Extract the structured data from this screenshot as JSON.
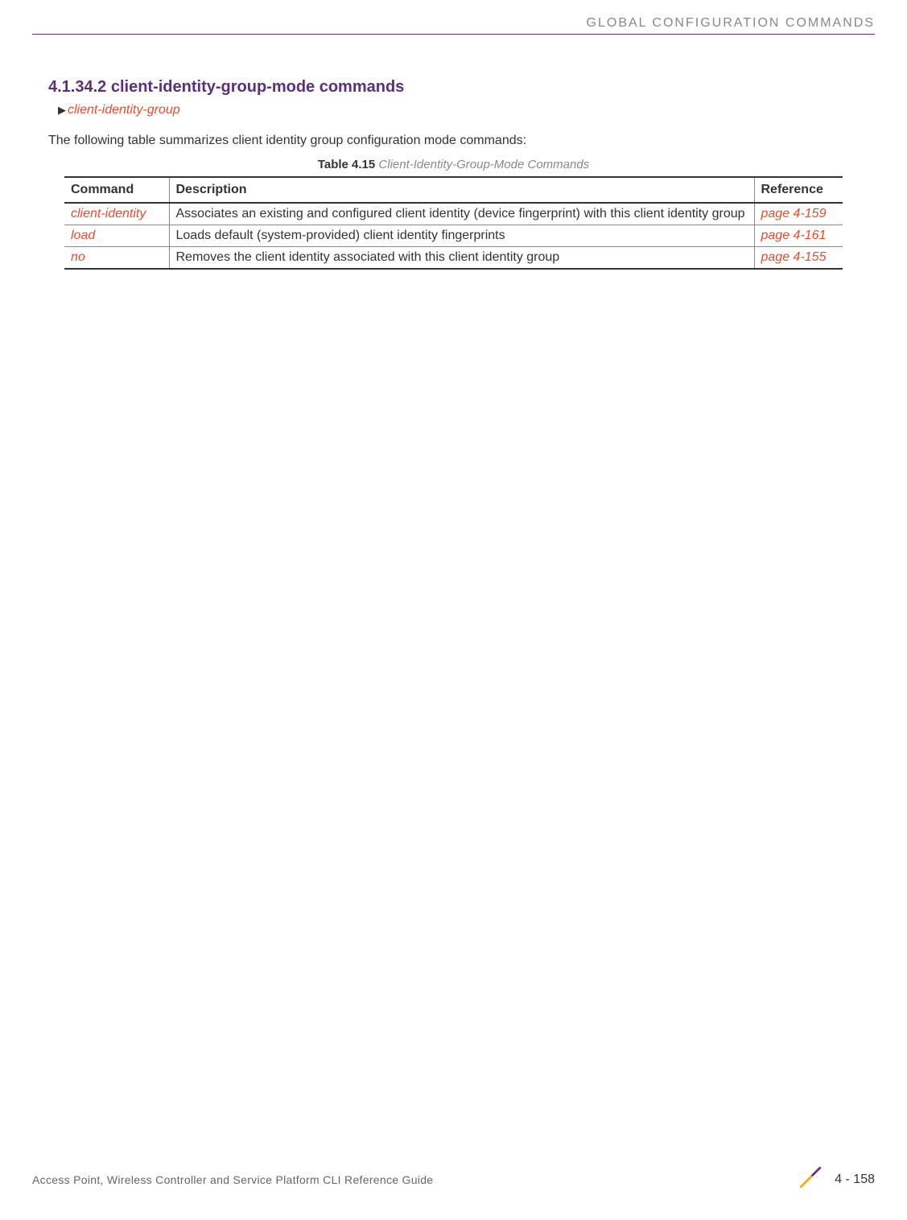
{
  "header": {
    "running_title": "GLOBAL CONFIGURATION COMMANDS"
  },
  "section": {
    "number_and_title": "4.1.34.2 client-identity-group-mode commands",
    "breadcrumb": "client-identity-group",
    "intro": "The following table summarizes client identity group configuration mode commands:"
  },
  "table": {
    "caption_label": "Table 4.15",
    "caption_title": " Client-Identity-Group-Mode Commands",
    "headers": {
      "command": "Command",
      "description": "Description",
      "reference": "Reference"
    },
    "rows": [
      {
        "command": "client-identity",
        "description": "Associates an existing and configured client identity (device fingerprint) with this client identity group",
        "reference": "page 4-159"
      },
      {
        "command": "load",
        "description": "Loads default (system-provided) client identity fingerprints",
        "reference": "page 4-161"
      },
      {
        "command": "no",
        "description": "Removes the client identity associated with this client identity group",
        "reference": "page 4-155"
      }
    ]
  },
  "footer": {
    "guide_title": "Access Point, Wireless Controller and Service Platform CLI Reference Guide",
    "page_number": "4 - 158"
  }
}
